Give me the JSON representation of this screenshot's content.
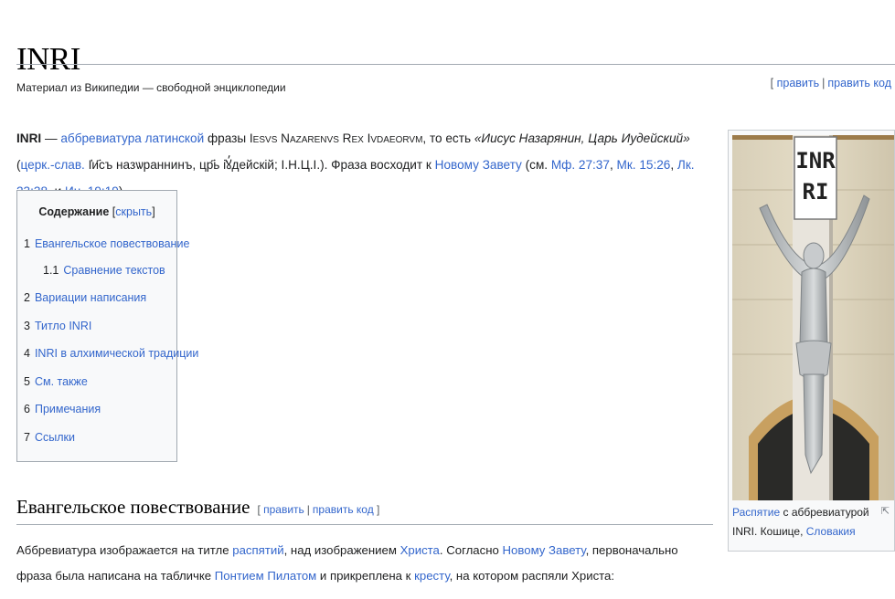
{
  "page": {
    "title": "INRI",
    "subtitle": "Материал из Википедии — свободной энциклопедии",
    "top_edit": {
      "open": "[ ",
      "edit": "править",
      "sep": "|",
      "edit_code": "править код"
    }
  },
  "lead": {
    "term": "INRI",
    "dash": " — ",
    "abbr_link": "аббревиатура",
    "sp1": " ",
    "latin_link": "латинской",
    "t1": " фразы ",
    "latin_phrase": "Iesvs Nazarenvs Rex Ivdaeorvm",
    "t2": ", то есть ",
    "translation": "«Иисус Назарянин, Царь Иудейский»",
    "t3": " (",
    "slav_link": "церк.-слав.",
    "slav_text": " І҆и҃съ назѡраннинъ, цр҃ь і҆ꙋ̓дейскій; І.Н.Ц.І.). Фраза восходит к ",
    "nt_link": "Новому Завету",
    "t4": " (см. ",
    "mf": "Мф. 27:37",
    "c1": ", ",
    "mk": "Мк. 15:26",
    "c2": ", ",
    "lk": "Лк. 23:38",
    "c3": ", и ",
    "jn": "Ин. 19:19",
    "t5": ")."
  },
  "toc": {
    "heading": "Содержание",
    "toggle_open": " [",
    "toggle": "скрыть",
    "toggle_close": "]",
    "items": [
      {
        "num": "1",
        "label": "Евангельское повествование"
      },
      {
        "num": "1.1",
        "label": "Сравнение текстов"
      },
      {
        "num": "2",
        "label": "Вариации написания"
      },
      {
        "num": "3",
        "label": "Титло INRI"
      },
      {
        "num": "4",
        "label": "INRI в алхимической традиции"
      },
      {
        "num": "5",
        "label": "См. также"
      },
      {
        "num": "6",
        "label": "Примечания"
      },
      {
        "num": "7",
        "label": "Ссылки"
      }
    ]
  },
  "section": {
    "heading": "Евангельское повествование",
    "edit_open": "[ ",
    "edit": "править",
    "sep": "|",
    "edit_code": "править код",
    "edit_close": " ]"
  },
  "paragraph": {
    "p1": "Аббревиатура изображается на титле ",
    "l1": "распятий",
    "p2": ", над изображением ",
    "l2": "Христа",
    "p3": ". Согласно ",
    "l3": "Новому Завету",
    "p4": ", первоначально фраза была написана на табличке ",
    "l4": "Понтием Пилатом",
    "p5": " и прикреплена к ",
    "l5": "кресту",
    "p6": ", на котором распяли Христа:"
  },
  "thumb": {
    "plaque_line1": "INR",
    "plaque_line2": "RI",
    "caption_link1": "Распятие",
    "caption_t1": " с аббревиатурой INRI. Кошице, ",
    "caption_link2": "Словакия",
    "magnify_icon": "⇱"
  },
  "colors": {
    "link": "#3366cc",
    "text": "#202122",
    "rule": "#a2a9b1"
  }
}
